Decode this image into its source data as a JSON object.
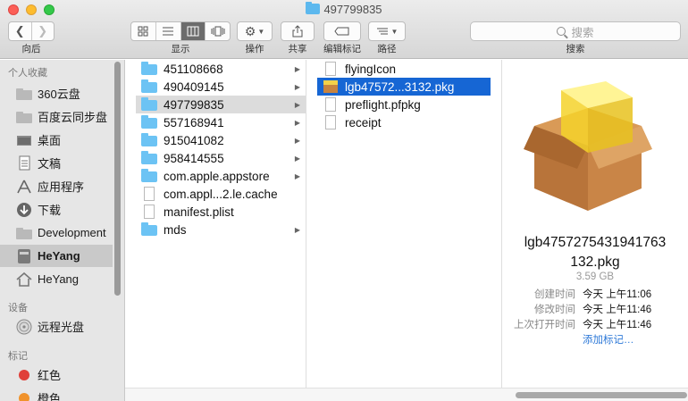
{
  "window": {
    "title": "497799835"
  },
  "toolbar": {
    "back_label": "向后",
    "view_label": "显示",
    "action_label": "操作",
    "share_label": "共享",
    "tag_label": "编辑标记",
    "path_label": "路径",
    "search_label": "搜索",
    "search_placeholder": "搜索"
  },
  "sidebar": {
    "favorites_header": "个人收藏",
    "devices_header": "设备",
    "tags_header": "标记",
    "favorites": [
      {
        "label": "360云盘",
        "icon": "folder-icon"
      },
      {
        "label": "百度云同步盘",
        "icon": "folder-icon"
      },
      {
        "label": "桌面",
        "icon": "desktop-icon"
      },
      {
        "label": "文稿",
        "icon": "documents-icon"
      },
      {
        "label": "应用程序",
        "icon": "applications-icon"
      },
      {
        "label": "下载",
        "icon": "downloads-icon"
      },
      {
        "label": "Development",
        "icon": "folder-icon"
      },
      {
        "label": "HeYang",
        "icon": "computer-icon"
      },
      {
        "label": "HeYang",
        "icon": "home-icon"
      }
    ],
    "devices": [
      {
        "label": "远程光盘",
        "icon": "disc-icon"
      }
    ],
    "tags": [
      {
        "label": "红色",
        "color": "#e0403a"
      },
      {
        "label": "橙色",
        "color": "#f0922b"
      }
    ]
  },
  "column1": {
    "items": [
      {
        "name": "451108668",
        "type": "folder"
      },
      {
        "name": "490409145",
        "type": "folder"
      },
      {
        "name": "497799835",
        "type": "folder"
      },
      {
        "name": "557168941",
        "type": "folder"
      },
      {
        "name": "915041082",
        "type": "folder"
      },
      {
        "name": "958414555",
        "type": "folder"
      },
      {
        "name": "com.apple.appstore",
        "type": "folder"
      },
      {
        "name": "com.appl...2.le.cache",
        "type": "file"
      },
      {
        "name": "manifest.plist",
        "type": "file"
      },
      {
        "name": "mds",
        "type": "folder"
      }
    ]
  },
  "column2": {
    "items": [
      {
        "name": "flyingIcon",
        "type": "file"
      },
      {
        "name": "lgb47572...3132.pkg",
        "type": "pkg"
      },
      {
        "name": "preflight.pfpkg",
        "type": "file"
      },
      {
        "name": "receipt",
        "type": "file"
      }
    ]
  },
  "preview": {
    "filename_line1": "lgb4757275431941763",
    "filename_line2": "132.pkg",
    "size": "3.59 GB",
    "created_label": "创建时间",
    "created_value": "今天 上午11:06",
    "modified_label": "修改时间",
    "modified_value": "今天 上午11:46",
    "opened_label": "上次打开时间",
    "opened_value": "今天 上午11:46",
    "add_tag": "添加标记…"
  }
}
